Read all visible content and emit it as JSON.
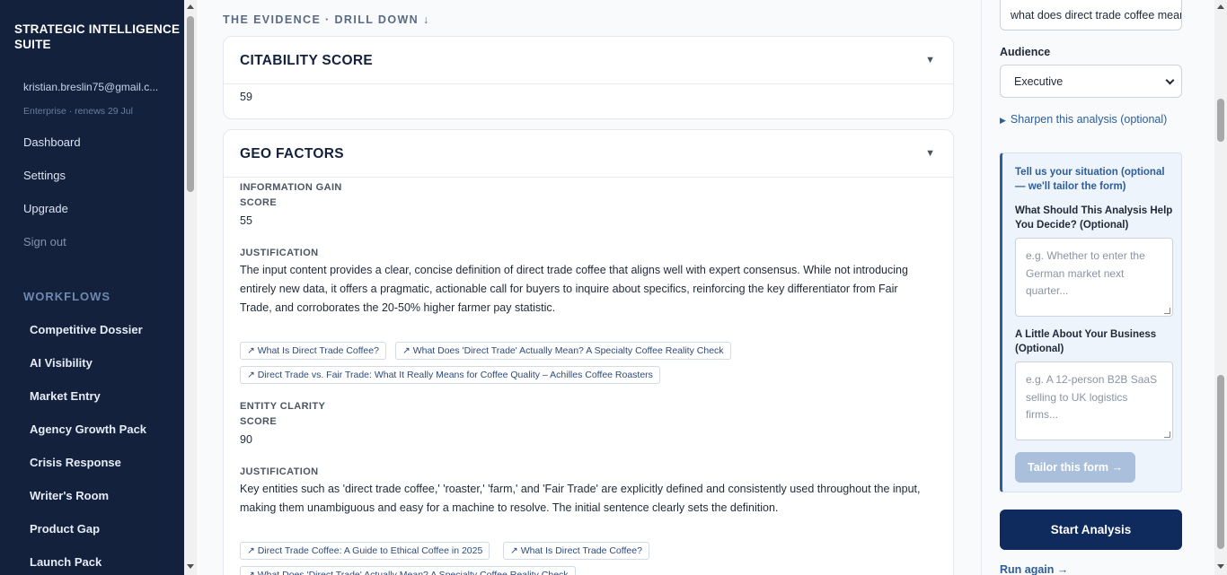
{
  "sidebar": {
    "brand": "STRATEGIC INTELLIGENCE SUITE",
    "email": "kristian.breslin75@gmail.c...",
    "plan": "Enterprise · renews 29 Jul",
    "nav": [
      "Dashboard",
      "Settings",
      "Upgrade",
      "Sign out"
    ],
    "workflows_heading": "WORKFLOWS",
    "workflows": [
      "Competitive Dossier",
      "AI Visibility",
      "Market Entry",
      "Agency Growth Pack",
      "Crisis Response",
      "Writer's Room",
      "Product Gap",
      "Launch Pack"
    ]
  },
  "main": {
    "evidence_heading": "THE EVIDENCE · DRILL DOWN ↓",
    "citability": {
      "title": "CITABILITY SCORE",
      "caret": "▼",
      "value": "59"
    },
    "geo": {
      "title": "GEO FACTORS",
      "caret": "▼",
      "factors": [
        {
          "name": "INFORMATION GAIN",
          "score_label": "SCORE",
          "score": "55",
          "justification_label": "JUSTIFICATION",
          "justification": "The input content provides a clear, concise definition of direct trade coffee that aligns well with expert consensus. While not introducing entirely new data, it offers a pragmatic, actionable call for buyers to inquire about specifics, reinforcing the key differentiator from Fair Trade, and corroborates the 20-50% higher farmer pay statistic.",
          "sources": [
            "↗ What Is Direct Trade Coffee?",
            "↗ What Does 'Direct Trade' Actually Mean? A Specialty Coffee Reality Check",
            "↗ Direct Trade vs. Fair Trade: What It Really Means for Coffee Quality – Achilles Coffee Roasters"
          ]
        },
        {
          "name": "ENTITY CLARITY",
          "score_label": "SCORE",
          "score": "90",
          "justification_label": "JUSTIFICATION",
          "justification": "Key entities such as 'direct trade coffee,' 'roaster,' 'farm,' and 'Fair Trade' are explicitly defined and consistently used throughout the input, making them unambiguous and easy for a machine to resolve. The initial sentence clearly sets the definition.",
          "sources": [
            "↗ Direct Trade Coffee: A Guide to Ethical Coffee in 2025",
            "↗ What Is Direct Trade Coffee?",
            "↗ What Does 'Direct Trade' Actually Mean? A Specialty Coffee Reality Check"
          ]
        }
      ]
    }
  },
  "right": {
    "query_value": "what does direct trade coffee mean",
    "audience_label": "Audience",
    "audience_value": "Executive",
    "sharpen_label": "Sharpen this analysis (optional)",
    "tailor": {
      "title": "Tell us your situation (optional — we'll tailor the form)",
      "q1": "What Should This Analysis Help You Decide? (Optional)",
      "q1_placeholder": "e.g. Whether to enter the German market next quarter...",
      "q2": "A Little About Your Business (Optional)",
      "q2_placeholder": "e.g. A 12-person B2B SaaS selling to UK logistics firms...",
      "button": "Tailor this form →"
    },
    "start_button": "Start Analysis",
    "run_again": "Run again →"
  }
}
